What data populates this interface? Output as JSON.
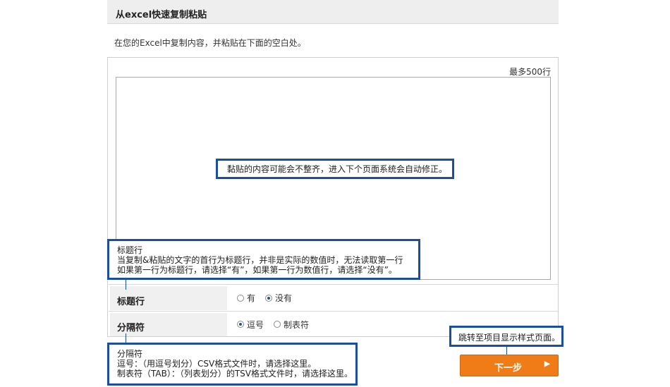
{
  "section": {
    "title": "从excel快速复制粘贴"
  },
  "instruction": "在您的Excel中复制内容，并粘贴在下面的空白处。",
  "panel": {
    "max_rows": "最多500行"
  },
  "paste_area": {
    "value": ""
  },
  "header_row": {
    "label": "标题行",
    "options": [
      {
        "label": "有",
        "selected": false
      },
      {
        "label": "没有",
        "selected": true
      }
    ]
  },
  "delimiter_row": {
    "label": "分隔符",
    "options": [
      {
        "label": "逗号",
        "selected": true
      },
      {
        "label": "制表符",
        "selected": false
      }
    ]
  },
  "callouts": {
    "paste_note": "黏贴的内容可能会不整齐，进入下个页面系统会自动修正。",
    "header_title": "标题行",
    "header_line1": "当复制&粘贴的文字的首行为标题行，并非是实际的数值时，无法读取第一行",
    "header_line2": "如果第一行为标题行，请选择“有”，如果第一行为数值行，请选择“没有”。",
    "delim_title": "分隔符",
    "delim_line1": "逗号：（用逗号划分）CSV格式文件时，请选择这里。",
    "delim_line2": "制表符（TAB）：（列表划分）的TSV格式文件时，请选择这里。",
    "next_note": "跳转至项目显示样式页面。"
  },
  "next_button": {
    "label": "下一步",
    "icon": "triangle-right-icon"
  },
  "colors": {
    "accent": "#1a4f9e",
    "button": "#f07c17"
  }
}
